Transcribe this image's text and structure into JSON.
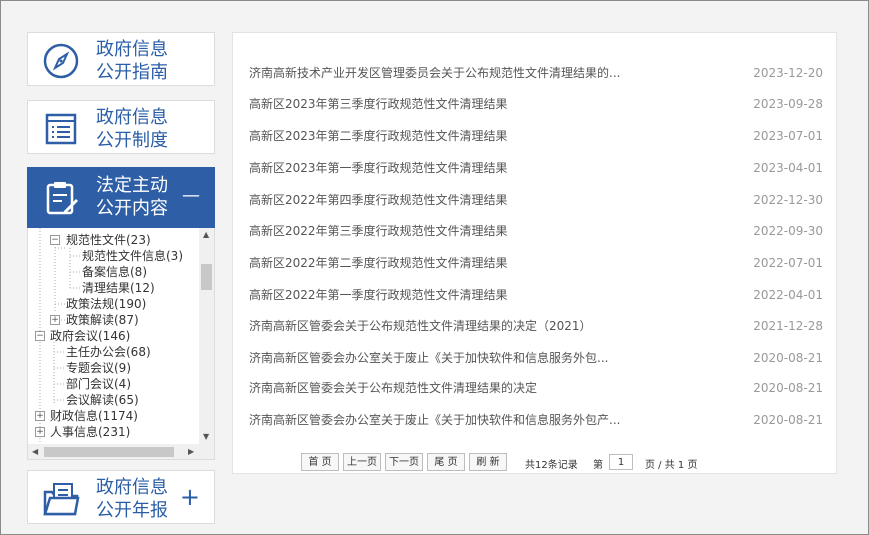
{
  "sidebar": {
    "guide": {
      "line1": "政府信息",
      "line2": "公开指南"
    },
    "system": {
      "line1": "政府信息",
      "line2": "公开制度"
    },
    "content": {
      "line1": "法定主动",
      "line2": "公开内容",
      "toggle": "—"
    },
    "annual": {
      "line1": "政府信息",
      "line2": "公开年报",
      "toggle": "+"
    },
    "tree": [
      {
        "label": "规范性文件(23)",
        "toggle": "−"
      },
      {
        "label": "规范性文件信息(3)"
      },
      {
        "label": "备案信息(8)"
      },
      {
        "label": "清理结果(12)"
      },
      {
        "label": "政策法规(190)"
      },
      {
        "label": "政策解读(87)",
        "toggle": "+"
      },
      {
        "label": "政府会议(146)",
        "toggle": "−"
      },
      {
        "label": "主任办公会(68)"
      },
      {
        "label": "专题会议(9)"
      },
      {
        "label": "部门会议(4)"
      },
      {
        "label": "会议解读(65)"
      },
      {
        "label": "财政信息(1174)",
        "toggle": "+"
      },
      {
        "label": "人事信息(231)",
        "toggle": "+"
      }
    ]
  },
  "list": [
    {
      "title": "济南高新技术产业开发区管理委员会关于公布规范性文件清理结果的...",
      "date": "2023-12-20"
    },
    {
      "title": "高新区2023年第三季度行政规范性文件清理结果",
      "date": "2023-09-28"
    },
    {
      "title": "高新区2023年第二季度行政规范性文件清理结果",
      "date": "2023-07-01"
    },
    {
      "title": "高新区2023年第一季度行政规范性文件清理结果",
      "date": "2023-04-01"
    },
    {
      "title": "高新区2022年第四季度行政规范性文件清理结果",
      "date": "2022-12-30"
    },
    {
      "title": "高新区2022年第三季度行政规范性文件清理结果",
      "date": "2022-09-30"
    },
    {
      "title": "高新区2022年第二季度行政规范性文件清理结果",
      "date": "2022-07-01"
    },
    {
      "title": "高新区2022年第一季度行政规范性文件清理结果",
      "date": "2022-04-01"
    },
    {
      "title": "济南高新区管委会关于公布规范性文件清理结果的决定（2021）",
      "date": "2021-12-28"
    },
    {
      "title": "济南高新区管委会办公室关于废止《关于加快软件和信息服务外包...",
      "date": "2020-08-21"
    },
    {
      "title": "济南高新区管委会关于公布规范性文件清理结果的决定",
      "date": "2020-08-21"
    },
    {
      "title": "济南高新区管委会办公室关于废止《关于加快软件和信息服务外包产...",
      "date": "2020-08-21"
    }
  ],
  "pager": {
    "first": "首 页",
    "prev": "上一页",
    "next": "下一页",
    "last": "尾 页",
    "refresh": "刷 新",
    "total": "共12条记录",
    "page_prefix": "第",
    "page_value": "1",
    "page_suffix": "页 / 共 1 页"
  },
  "colors": {
    "accent": "#2e5fa6",
    "text": "#555555",
    "date": "#999999"
  },
  "icons": [
    "compass-icon",
    "document-list-icon",
    "clipboard-edit-icon",
    "folder-report-icon",
    "scroll-up-icon",
    "scroll-down-icon",
    "scroll-left-icon",
    "scroll-right-icon"
  ]
}
